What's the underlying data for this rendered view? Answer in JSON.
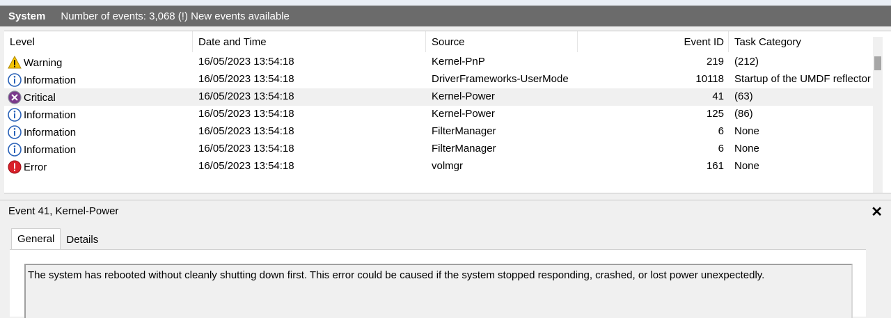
{
  "titlebar": {
    "title": "System",
    "subtitle": "Number of events: 3,068 (!) New events available"
  },
  "columns": {
    "level": "Level",
    "datetime": "Date and Time",
    "source": "Source",
    "event_id": "Event ID",
    "task_category": "Task Category"
  },
  "rows": [
    {
      "level": "Warning",
      "icon": "warning-icon",
      "datetime": "16/05/2023 13:54:18",
      "source": "Kernel-PnP",
      "event_id": "219",
      "task_category": "(212)"
    },
    {
      "level": "Information",
      "icon": "information-icon",
      "datetime": "16/05/2023 13:54:18",
      "source": "DriverFrameworks-UserMode",
      "event_id": "10118",
      "task_category": "Startup of the UMDF reflector"
    },
    {
      "level": "Critical",
      "icon": "critical-icon",
      "datetime": "16/05/2023 13:54:18",
      "source": "Kernel-Power",
      "event_id": "41",
      "task_category": "(63)"
    },
    {
      "level": "Information",
      "icon": "information-icon",
      "datetime": "16/05/2023 13:54:18",
      "source": "Kernel-Power",
      "event_id": "125",
      "task_category": "(86)"
    },
    {
      "level": "Information",
      "icon": "information-icon",
      "datetime": "16/05/2023 13:54:18",
      "source": "FilterManager",
      "event_id": "6",
      "task_category": "None"
    },
    {
      "level": "Information",
      "icon": "information-icon",
      "datetime": "16/05/2023 13:54:18",
      "source": "FilterManager",
      "event_id": "6",
      "task_category": "None"
    },
    {
      "level": "Error",
      "icon": "error-icon",
      "datetime": "16/05/2023 13:54:18",
      "source": "volmgr",
      "event_id": "161",
      "task_category": "None"
    }
  ],
  "detail": {
    "title": "Event 41, Kernel-Power",
    "close_label": "✕",
    "tabs": [
      "General",
      "Details"
    ],
    "message": "The system has rebooted without cleanly shutting down first. This error could be caused if the system stopped responding, crashed, or lost power unexpectedly."
  },
  "colors": {
    "titlebar_bg": "#6b6b6b",
    "selected_row": "#f0f0f0",
    "warning": "#f5c400",
    "information": "#2a62b8",
    "critical": "#7a3a8c",
    "error": "#d9202a"
  }
}
